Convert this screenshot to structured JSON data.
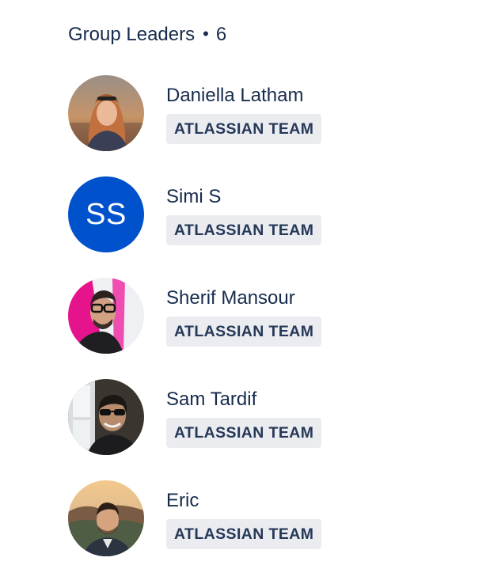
{
  "group": {
    "title": "Group Leaders",
    "separator": "•",
    "count": "6"
  },
  "leaders": [
    {
      "name": "Daniella Latham",
      "badge": "ATLASSIAN TEAM",
      "avatar": "photo-avatar"
    },
    {
      "name": "Simi S",
      "badge": "ATLASSIAN TEAM",
      "avatar": "initials-avatar",
      "initials": "SS",
      "avatar_color": "#0052CC"
    },
    {
      "name": "Sherif Mansour",
      "badge": "ATLASSIAN TEAM",
      "avatar": "photo-avatar"
    },
    {
      "name": "Sam Tardif",
      "badge": "ATLASSIAN TEAM",
      "avatar": "photo-avatar"
    },
    {
      "name": "Eric",
      "badge": "ATLASSIAN TEAM",
      "avatar": "photo-avatar"
    }
  ],
  "colors": {
    "text": "#172B4D",
    "badge_bg": "#EBECF0",
    "badge_text": "#253858",
    "brand_blue": "#0052CC"
  }
}
